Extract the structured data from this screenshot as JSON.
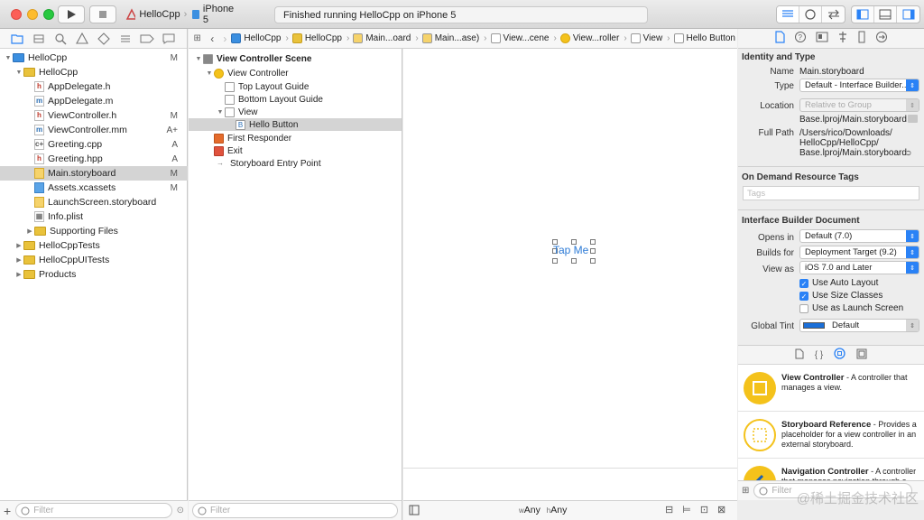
{
  "toolbar": {
    "scheme_name": "HelloCpp",
    "device_name": "iPhone 5",
    "activity_text": "Finished running HelloCpp on iPhone 5"
  },
  "navigator": {
    "items": [
      {
        "label": "HelloCpp",
        "badge": "M",
        "kind": "project",
        "depth": 0,
        "expanded": true
      },
      {
        "label": "HelloCpp",
        "badge": "",
        "kind": "folder",
        "depth": 1,
        "expanded": true
      },
      {
        "label": "AppDelegate.h",
        "badge": "",
        "kind": "h",
        "depth": 2
      },
      {
        "label": "AppDelegate.m",
        "badge": "",
        "kind": "m",
        "depth": 2
      },
      {
        "label": "ViewController.h",
        "badge": "M",
        "kind": "h",
        "depth": 2
      },
      {
        "label": "ViewController.mm",
        "badge": "A+",
        "kind": "m",
        "depth": 2
      },
      {
        "label": "Greeting.cpp",
        "badge": "A",
        "kind": "c",
        "depth": 2
      },
      {
        "label": "Greeting.hpp",
        "badge": "A",
        "kind": "h",
        "depth": 2
      },
      {
        "label": "Main.storyboard",
        "badge": "M",
        "kind": "sb",
        "depth": 2,
        "selected": true
      },
      {
        "label": "Assets.xcassets",
        "badge": "M",
        "kind": "assets",
        "depth": 2
      },
      {
        "label": "LaunchScreen.storyboard",
        "badge": "",
        "kind": "sb",
        "depth": 2
      },
      {
        "label": "Info.plist",
        "badge": "",
        "kind": "plist",
        "depth": 2
      },
      {
        "label": "Supporting Files",
        "badge": "",
        "kind": "folder",
        "depth": 2,
        "expanded": false
      },
      {
        "label": "HelloCppTests",
        "badge": "",
        "kind": "folder",
        "depth": 1,
        "expanded": false
      },
      {
        "label": "HelloCppUITests",
        "badge": "",
        "kind": "folder",
        "depth": 1,
        "expanded": false
      },
      {
        "label": "Products",
        "badge": "",
        "kind": "folder",
        "depth": 1,
        "expanded": false
      }
    ],
    "filter_placeholder": "Filter"
  },
  "jumpbar": {
    "crumbs": [
      "HelloCpp",
      "HelloCpp",
      "Main...oard",
      "Main...ase)",
      "View...cene",
      "View...roller",
      "View",
      "Hello Button"
    ]
  },
  "outline": {
    "items": [
      {
        "label": "View Controller Scene",
        "depth": 0,
        "bold": true,
        "kind": "scene"
      },
      {
        "label": "View Controller",
        "depth": 1,
        "kind": "vc"
      },
      {
        "label": "Top Layout Guide",
        "depth": 2,
        "kind": "box"
      },
      {
        "label": "Bottom Layout Guide",
        "depth": 2,
        "kind": "box"
      },
      {
        "label": "View",
        "depth": 2,
        "kind": "box"
      },
      {
        "label": "Hello Button",
        "depth": 3,
        "kind": "button",
        "selected": true
      },
      {
        "label": "First Responder",
        "depth": 1,
        "kind": "responder"
      },
      {
        "label": "Exit",
        "depth": 1,
        "kind": "exit"
      },
      {
        "label": "Storyboard Entry Point",
        "depth": 1,
        "kind": "arrow"
      }
    ],
    "filter_placeholder": "Filter"
  },
  "canvas": {
    "button_text": "Tap Me",
    "size_class_w": "w",
    "size_class_w_value": "Any",
    "size_class_h": "h",
    "size_class_h_value": "Any"
  },
  "inspector": {
    "identity_header": "Identity and Type",
    "name_label": "Name",
    "name_value": "Main.storyboard",
    "type_label": "Type",
    "type_value": "Default - Interface Builder...",
    "location_label": "Location",
    "location_value": "Relative to Group",
    "location_file": "Base.lproj/Main.storyboard",
    "fullpath_label": "Full Path",
    "fullpath_line1": "/Users/rico/Downloads/",
    "fullpath_line2": "HelloCpp/HelloCpp/",
    "fullpath_line3": "Base.lproj/Main.storyboard",
    "tags_header": "On Demand Resource Tags",
    "tags_placeholder": "Tags",
    "ibdoc_header": "Interface Builder Document",
    "opens_in_label": "Opens in",
    "opens_in_value": "Default (7.0)",
    "builds_for_label": "Builds for",
    "builds_for_value": "Deployment Target (9.2)",
    "view_as_label": "View as",
    "view_as_value": "iOS 7.0 and Later",
    "check_auto_layout": "Use Auto Layout",
    "check_size_classes": "Use Size Classes",
    "check_launch_screen": "Use as Launch Screen",
    "global_tint_label": "Global Tint",
    "global_tint_value": "Default",
    "tint_color": "#1a6fd9"
  },
  "library": {
    "items": [
      {
        "title": "View Controller",
        "desc": " - A controller that manages a view."
      },
      {
        "title": "Storyboard Reference",
        "desc": " - Provides a placeholder for a view controller in an external storyboard."
      },
      {
        "title": "Navigation Controller",
        "desc": " - A controller that manages navigation through a hierarchy of views."
      }
    ],
    "filter_placeholder": "Filter"
  },
  "watermark": "@稀土掘金技术社区",
  "colors": {
    "accent": "#2a82f6",
    "folder": "#e9c23b",
    "library_icon": "#f4c21b"
  }
}
